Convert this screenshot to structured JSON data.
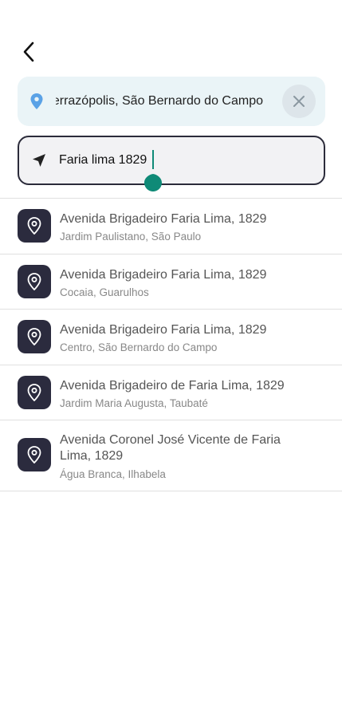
{
  "origin": {
    "value": "Ferrazópolis, São Bernardo do Campo",
    "icon": "location-pin-icon",
    "accent": "#5aa2e6"
  },
  "destination": {
    "value": "Faria lima 1829",
    "icon": "navigation-arrow-icon"
  },
  "results": [
    {
      "title": "Avenida Brigadeiro Faria Lima, 1829",
      "subtitle": "Jardim Paulistano, São Paulo"
    },
    {
      "title": "Avenida Brigadeiro Faria Lima, 1829",
      "subtitle": "Cocaia, Guarulhos"
    },
    {
      "title": "Avenida Brigadeiro Faria Lima, 1829",
      "subtitle": "Centro, São Bernardo do Campo"
    },
    {
      "title": "Avenida Brigadeiro de Faria Lima, 1829",
      "subtitle": "Jardim Maria Augusta, Taubaté"
    },
    {
      "title": "Avenida Coronel José Vicente de Faria Lima, 1829",
      "subtitle": "Água Branca, Ilhabela"
    }
  ],
  "colors": {
    "caret": "#0f8a77",
    "result_icon_bg": "#2b2b3e"
  }
}
